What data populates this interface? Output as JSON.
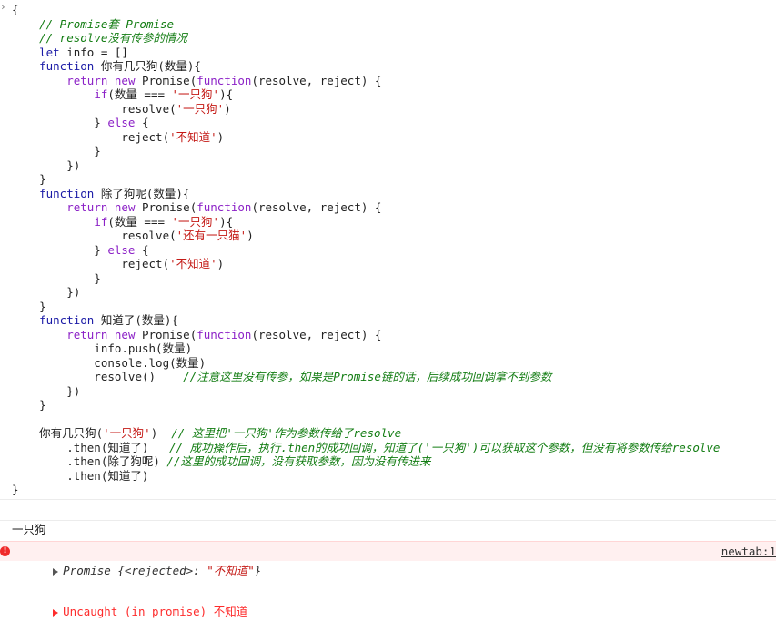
{
  "console": {
    "code_lines": [
      [
        {
          "t": "{",
          "c": "pl"
        }
      ],
      [
        {
          "t": "    // Promise套 Promise",
          "c": "cm"
        }
      ],
      [
        {
          "t": "    // resolve没有传参的情况",
          "c": "cm"
        }
      ],
      [
        {
          "t": "    ",
          "c": "pl"
        },
        {
          "t": "let",
          "c": "kwb"
        },
        {
          "t": " info = []",
          "c": "pl"
        }
      ],
      [
        {
          "t": "    ",
          "c": "pl"
        },
        {
          "t": "function",
          "c": "kwb"
        },
        {
          "t": " 你有几只狗(数量){",
          "c": "pl"
        }
      ],
      [
        {
          "t": "        ",
          "c": "pl"
        },
        {
          "t": "return new",
          "c": "kw"
        },
        {
          "t": " Promise(",
          "c": "pl"
        },
        {
          "t": "function",
          "c": "kw"
        },
        {
          "t": "(resolve, reject) {",
          "c": "pl"
        }
      ],
      [
        {
          "t": "            ",
          "c": "pl"
        },
        {
          "t": "if",
          "c": "kw"
        },
        {
          "t": "(数量 === ",
          "c": "pl"
        },
        {
          "t": "'一只狗'",
          "c": "str"
        },
        {
          "t": "){",
          "c": "pl"
        }
      ],
      [
        {
          "t": "                resolve(",
          "c": "pl"
        },
        {
          "t": "'一只狗'",
          "c": "str"
        },
        {
          "t": ")",
          "c": "pl"
        }
      ],
      [
        {
          "t": "            } ",
          "c": "pl"
        },
        {
          "t": "else",
          "c": "kw"
        },
        {
          "t": " {",
          "c": "pl"
        }
      ],
      [
        {
          "t": "                reject(",
          "c": "pl"
        },
        {
          "t": "'不知道'",
          "c": "str"
        },
        {
          "t": ")",
          "c": "pl"
        }
      ],
      [
        {
          "t": "            }",
          "c": "pl"
        }
      ],
      [
        {
          "t": "        })",
          "c": "pl"
        }
      ],
      [
        {
          "t": "    }",
          "c": "pl"
        }
      ],
      [
        {
          "t": "    ",
          "c": "pl"
        },
        {
          "t": "function",
          "c": "kwb"
        },
        {
          "t": " 除了狗呢(数量){",
          "c": "pl"
        }
      ],
      [
        {
          "t": "        ",
          "c": "pl"
        },
        {
          "t": "return new",
          "c": "kw"
        },
        {
          "t": " Promise(",
          "c": "pl"
        },
        {
          "t": "function",
          "c": "kw"
        },
        {
          "t": "(resolve, reject) {",
          "c": "pl"
        }
      ],
      [
        {
          "t": "            ",
          "c": "pl"
        },
        {
          "t": "if",
          "c": "kw"
        },
        {
          "t": "(数量 === ",
          "c": "pl"
        },
        {
          "t": "'一只狗'",
          "c": "str"
        },
        {
          "t": "){",
          "c": "pl"
        }
      ],
      [
        {
          "t": "                resolve(",
          "c": "pl"
        },
        {
          "t": "'还有一只猫'",
          "c": "str"
        },
        {
          "t": ")",
          "c": "pl"
        }
      ],
      [
        {
          "t": "            } ",
          "c": "pl"
        },
        {
          "t": "else",
          "c": "kw"
        },
        {
          "t": " {",
          "c": "pl"
        }
      ],
      [
        {
          "t": "                reject(",
          "c": "pl"
        },
        {
          "t": "'不知道'",
          "c": "str"
        },
        {
          "t": ")",
          "c": "pl"
        }
      ],
      [
        {
          "t": "            }",
          "c": "pl"
        }
      ],
      [
        {
          "t": "        })",
          "c": "pl"
        }
      ],
      [
        {
          "t": "    }",
          "c": "pl"
        }
      ],
      [
        {
          "t": "    ",
          "c": "pl"
        },
        {
          "t": "function",
          "c": "kwb"
        },
        {
          "t": " 知道了(数量){",
          "c": "pl"
        }
      ],
      [
        {
          "t": "        ",
          "c": "pl"
        },
        {
          "t": "return new",
          "c": "kw"
        },
        {
          "t": " Promise(",
          "c": "pl"
        },
        {
          "t": "function",
          "c": "kw"
        },
        {
          "t": "(resolve, reject) {",
          "c": "pl"
        }
      ],
      [
        {
          "t": "            info.push(数量)",
          "c": "pl"
        }
      ],
      [
        {
          "t": "            console.log(数量)",
          "c": "pl"
        }
      ],
      [
        {
          "t": "            resolve()    ",
          "c": "pl"
        },
        {
          "t": "//注意这里没有传参，如果是Promise链的话，后续成功回调拿不到参数",
          "c": "cm"
        }
      ],
      [
        {
          "t": "        })",
          "c": "pl"
        }
      ],
      [
        {
          "t": "    }",
          "c": "pl"
        }
      ],
      [
        {
          "t": "",
          "c": "pl"
        }
      ],
      [
        {
          "t": "    你有几只狗(",
          "c": "pl"
        },
        {
          "t": "'一只狗'",
          "c": "str"
        },
        {
          "t": ")  ",
          "c": "pl"
        },
        {
          "t": "// 这里把'一只狗'作为参数传给了resolve",
          "c": "cm"
        }
      ],
      [
        {
          "t": "        .then(知道了)   ",
          "c": "pl"
        },
        {
          "t": "// 成功操作后，执行.then的成功回调，知道了('一只狗')可以获取这个参数，但没有将参数传给resolve",
          "c": "cm"
        }
      ],
      [
        {
          "t": "        .then(除了狗呢) ",
          "c": "pl"
        },
        {
          "t": "//这里的成功回调，没有获取参数，因为没有传进来",
          "c": "cm"
        }
      ],
      [
        {
          "t": "        .then(知道了)",
          "c": "pl"
        }
      ],
      [
        {
          "t": "}",
          "c": "pl"
        }
      ]
    ],
    "log_output": "一只狗",
    "promise_output": {
      "prefix": "Promise {<rejected>: ",
      "value": "\"不知道\"",
      "suffix": "}"
    },
    "error_output": {
      "message": "Uncaught (in promise) 不知道",
      "source_link": "newtab:1"
    },
    "colors": {
      "comment": "#137d13",
      "keyword": "#8c22c7",
      "keyword_decl": "#1a1aa6",
      "string": "#c41a16",
      "error": "#fe2c2c",
      "error_bg": "#fff0f0"
    }
  }
}
